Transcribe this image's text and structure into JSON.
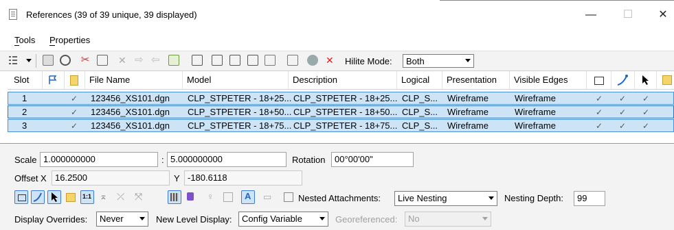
{
  "window": {
    "title": "References (39 of 39 unique, 39 displayed)",
    "controls": {
      "minimize": "—",
      "maximize": "☐",
      "close": "✕"
    }
  },
  "menu": {
    "items": [
      {
        "label": "Tools",
        "accel": "T"
      },
      {
        "label": "Properties",
        "accel": "P"
      }
    ]
  },
  "toolbar": {
    "hilite_label": "Hilite Mode:",
    "hilite_value": "Both",
    "icons": [
      "list-view-icon",
      "attach-icon",
      "attach-special-icon",
      "detach-icon",
      "reload-icon",
      "exchange-icon",
      "move-icon",
      "copy-icon",
      "scale-icon",
      "rotate-icon",
      "mirror-h-icon",
      "mirror-v-icon",
      "clip-boundary-icon",
      "clip-mask-icon",
      "clip-delete-icon",
      "globe-icon",
      "remove-icon"
    ]
  },
  "table": {
    "columns": [
      "Slot",
      "",
      "",
      "File Name",
      "Model",
      "Description",
      "Logical",
      "Presentation",
      "Visible Edges"
    ],
    "rows": [
      {
        "slot": "1",
        "check": "✓",
        "file": "123456_XS101.dgn",
        "model": "CLP_STPETER - 18+25...",
        "description": "CLP_STPETER - 18+25...",
        "logical": "CLP_S...",
        "presentation": "Wireframe",
        "edges": "Wireframe",
        "c1": "✓",
        "c2": "✓",
        "c3": "✓"
      },
      {
        "slot": "2",
        "check": "✓",
        "file": "123456_XS101.dgn",
        "model": "CLP_STPETER - 18+50...",
        "description": "CLP_STPETER - 18+50...",
        "logical": "CLP_S...",
        "presentation": "Wireframe",
        "edges": "Wireframe",
        "c1": "✓",
        "c2": "✓",
        "c3": "✓"
      },
      {
        "slot": "3",
        "check": "✓",
        "file": "123456_XS101.dgn",
        "model": "CLP_STPETER - 18+75...",
        "description": "CLP_STPETER - 18+75...",
        "logical": "CLP_S...",
        "presentation": "Wireframe",
        "edges": "Wireframe",
        "c1": "✓",
        "c2": "✓",
        "c3": "✓"
      }
    ]
  },
  "properties": {
    "scale_label": "Scale",
    "scale_value1": "1.000000000",
    "scale_sep": ":",
    "scale_value2": "5.000000000",
    "rotation_label": "Rotation",
    "rotation_value": "00°00'00\"",
    "offset_x_label": "Offset X",
    "offset_x_value": "16.2500",
    "offset_y_label": "Y",
    "offset_y_value": "-180.6118",
    "nested_label": "Nested Attachments:",
    "nested_value": "Live Nesting",
    "nesting_depth_label": "Nesting Depth:",
    "nesting_depth_value": "99",
    "display_overrides_label": "Display Overrides:",
    "display_overrides_value": "Never",
    "new_level_label": "New Level Display:",
    "new_level_value": "Config Variable",
    "georef_label": "Georeferenced:",
    "georef_value": "No"
  },
  "colors": {
    "selection": "#cde4f7",
    "selection_border": "#3a7bd5",
    "accent_blue": "#1e63c7"
  }
}
